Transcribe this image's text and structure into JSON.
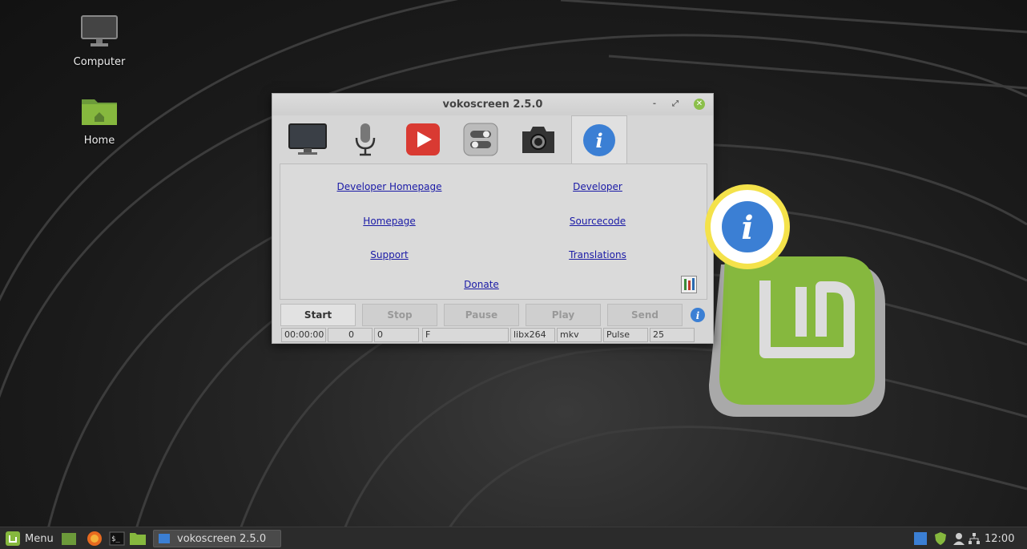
{
  "desktop": {
    "icons": [
      {
        "label": "Computer",
        "icon": "monitor-icon"
      },
      {
        "label": "Home",
        "icon": "home-folder-icon"
      }
    ]
  },
  "window": {
    "title": "vokoscreen 2.5.0",
    "controls": {
      "minimize": "-",
      "maximize": "⤢",
      "close": "✕"
    },
    "tabs": [
      {
        "icon": "screen-icon"
      },
      {
        "icon": "microphone-icon"
      },
      {
        "icon": "video-player-icon"
      },
      {
        "icon": "settings-toggle-icon"
      },
      {
        "icon": "camera-icon"
      },
      {
        "icon": "info-icon",
        "active": true
      }
    ],
    "about_links": {
      "developer_homepage": "Developer Homepage",
      "developer": "Developer",
      "homepage": "Homepage",
      "sourcecode": "Sourcecode",
      "support": "Support",
      "translations": "Translations",
      "donate": "Donate"
    },
    "buttons": {
      "start": "Start",
      "stop": "Stop",
      "pause": "Pause",
      "play": "Play",
      "send": "Send"
    },
    "statusbar": {
      "time": "00:00:00",
      "frames": "0",
      "size": "0",
      "fps_mode": "F",
      "codec": "libx264",
      "container": "mkv",
      "audio": "Pulse",
      "fps": "25"
    }
  },
  "callout": {
    "icon": "info-icon",
    "color": "#f4e24a"
  },
  "taskbar": {
    "menu_label": "Menu",
    "window_label": "vokoscreen 2.5.0",
    "clock": "12:00"
  },
  "colors": {
    "accent_blue": "#3b7fd4",
    "mint_green": "#8bbf4a",
    "link": "#1a1aa6"
  }
}
